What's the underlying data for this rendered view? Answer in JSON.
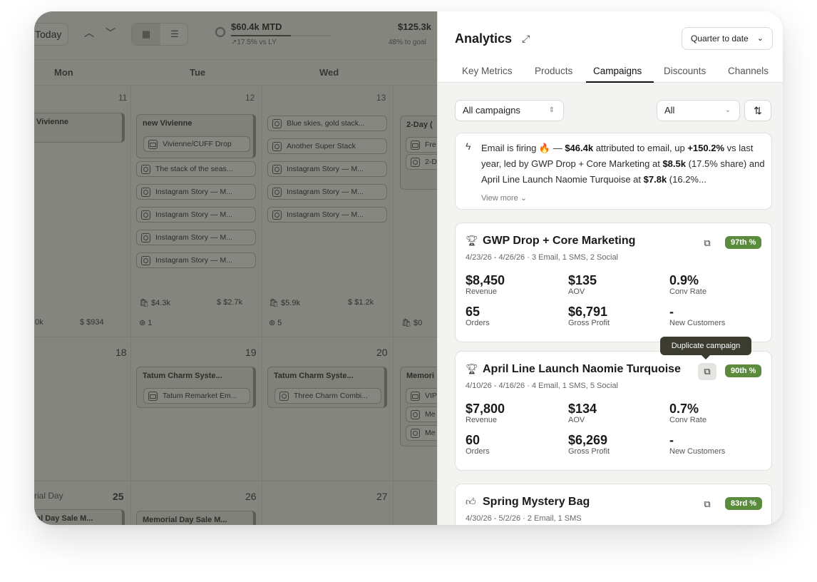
{
  "calendar": {
    "today_label": "Today",
    "kpi_mtd": {
      "value": "$60.4k MTD",
      "sub": "↗17.5% vs LY",
      "progress": 0.6
    },
    "kpi_goal": {
      "value": "$125.3k",
      "sub": "48% to goal"
    },
    "days": [
      "Mon",
      "Tue",
      "Wed"
    ],
    "week1": {
      "nums": [
        "11",
        "12",
        "13"
      ],
      "mon_event": "Vivienne",
      "tue_group_title": "new Vivienne",
      "tue_group_chip": "Vivienne/CUFF Drop",
      "tue_chips": [
        "The stack of the seas...",
        "Instagram Story — M...",
        "Instagram Story — M...",
        "Instagram Story — M...",
        "Instagram Story — M..."
      ],
      "wed_chips": [
        "Blue skies, gold stack...",
        "Another Super Stack",
        "Instagram Story — M...",
        "Instagram Story — M...",
        "Instagram Story — M..."
      ],
      "thu_title": "2-Day (",
      "thu_chips": [
        "Fre",
        "2-D"
      ],
      "mon_stats": [
        ".0k",
        "$ $934"
      ],
      "tue_stats": [
        "$4.3k",
        "$ $2.7k",
        "1"
      ],
      "wed_stats": [
        "$5.9k",
        "$ $1.2k",
        "5"
      ],
      "thu_stats": [
        "$0"
      ]
    },
    "week2": {
      "nums": [
        "18",
        "19",
        "20"
      ],
      "tue_title": "Tatum Charm Syste...",
      "tue_chip": "Tatum Remarket Em...",
      "wed_title": "Tatum Charm Syste...",
      "wed_chip": "Three Charm Combi...",
      "thu_title": "Memori",
      "thu_chips": [
        "VIP",
        "Me",
        "Me"
      ]
    },
    "week3": {
      "mon_label": "rial Day",
      "nums": [
        "25",
        "26",
        "27"
      ],
      "mon_event": "al Day Sale M...",
      "tue_event": "Memorial Day Sale M..."
    }
  },
  "analytics": {
    "title": "Analytics",
    "period": "Quarter to date",
    "tabs": [
      "Key Metrics",
      "Products",
      "Campaigns",
      "Discounts",
      "Channels"
    ],
    "active_tab": "Campaigns",
    "filter_campaigns": "All campaigns",
    "filter_all": "All",
    "insight": {
      "t1": "Email is firing 🔥 — ",
      "b1": "$46.4k",
      "t2": " attributed to email, up ",
      "b2": "+150.2%",
      "t3": " vs last year, led by GWP Drop + Core Marketing at ",
      "b3": "$8.5k",
      "t4": " (17.5% share) and April Line Launch Naomie Turquoise at ",
      "b4": "$7.8k",
      "t5": " (16.2%...",
      "more": "View more ⌄"
    },
    "tooltip": "Duplicate campaign",
    "campaigns": [
      {
        "icon": "trophy-icon",
        "title": "GWP Drop + Core Marketing",
        "dates": "4/23/26 - 4/26/26 · 3 Email, 1 SMS, 2 Social",
        "badge": "97th %",
        "revenue": "$8,450",
        "revenue_label": "Revenue",
        "aov": "$135",
        "aov_label": "AOV",
        "conv": "0.9%",
        "conv_label": "Conv Rate",
        "orders": "65",
        "orders_label": "Orders",
        "profit": "$6,791",
        "profit_label": "Gross Profit",
        "newcust": "-",
        "newcust_label": "New Customers"
      },
      {
        "icon": "trophy-icon",
        "title": "April Line Launch Naomie Turquoise",
        "dates": "4/10/26 - 4/16/26 · 4 Email, 1 SMS, 5 Social",
        "badge": "90th %",
        "revenue": "$7,800",
        "revenue_label": "Revenue",
        "aov": "$134",
        "aov_label": "AOV",
        "conv": "0.7%",
        "conv_label": "Conv Rate",
        "orders": "60",
        "orders_label": "Orders",
        "profit": "$6,269",
        "profit_label": "Gross Profit",
        "newcust": "-",
        "newcust_label": "New Customers"
      },
      {
        "icon": "thumbs-up-icon",
        "title": "Spring Mystery Bag",
        "dates": "4/30/26 - 5/2/26 · 2 Email, 1 SMS",
        "badge": "83rd %"
      }
    ]
  }
}
